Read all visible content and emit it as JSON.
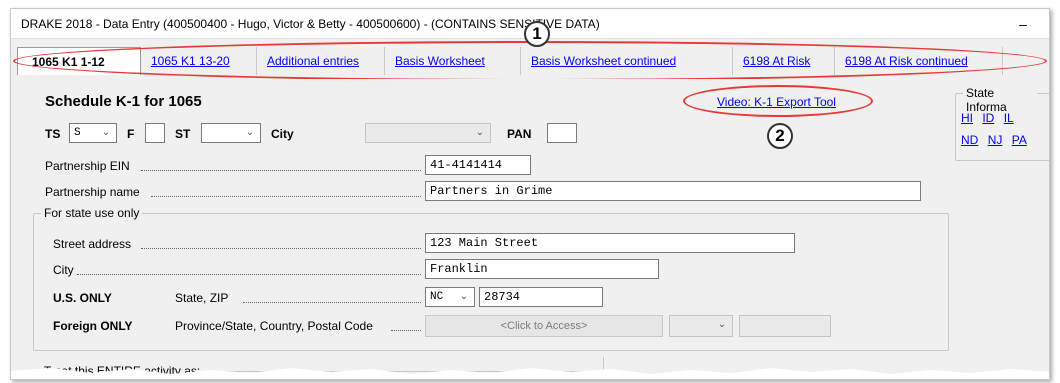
{
  "window": {
    "title": "DRAKE 2018 - Data Entry (400500400 - Hugo, Victor & Betty - 400500600) - (CONTAINS SENSITIVE DATA)",
    "minimize_label": "–"
  },
  "tabs": [
    {
      "label": "1065 K1  1-12",
      "active": true
    },
    {
      "label": "1065 K1 13-20",
      "active": false
    },
    {
      "label": "Additional entries",
      "active": false
    },
    {
      "label": "Basis Worksheet",
      "active": false
    },
    {
      "label": "Basis Worksheet continued",
      "active": false
    },
    {
      "label": "6198 At Risk",
      "active": false
    },
    {
      "label": "6198 At Risk continued",
      "active": false
    }
  ],
  "callouts": [
    "1",
    "2"
  ],
  "form": {
    "title": "Schedule K-1 for 1065",
    "video_link": "Video: K-1 Export Tool",
    "ts_label": "TS",
    "ts_value": "S",
    "f_label": "F",
    "st_label": "ST",
    "city_label": "City",
    "pan_label": "PAN",
    "ein_label": "Partnership EIN",
    "ein_value": "41-4141414",
    "name_label": "Partnership name",
    "name_value": "Partners in Grime",
    "state_use_title": "For state use only",
    "street_label": "Street address",
    "street_value": "123 Main Street",
    "city2_label": "City",
    "city2_value": "Franklin",
    "us_only_label": "U.S. ONLY",
    "state_zip_label": "State, ZIP",
    "state_value": "NC",
    "zip_value": "28734",
    "foreign_only_label": "Foreign ONLY",
    "province_label": "Province/State, Country, Postal Code",
    "click_access": "<Click to Access>",
    "treat_label": "Treat this ENTIRE activity as:"
  },
  "state_info": {
    "title": "State Informa",
    "row1": [
      "HI",
      "ID",
      "IL"
    ],
    "row2": [
      "ND",
      "NJ",
      "PA"
    ]
  },
  "colors": {
    "callout": "#e53935",
    "link": "#0000ee",
    "window_bg": "#f0f0f0"
  }
}
